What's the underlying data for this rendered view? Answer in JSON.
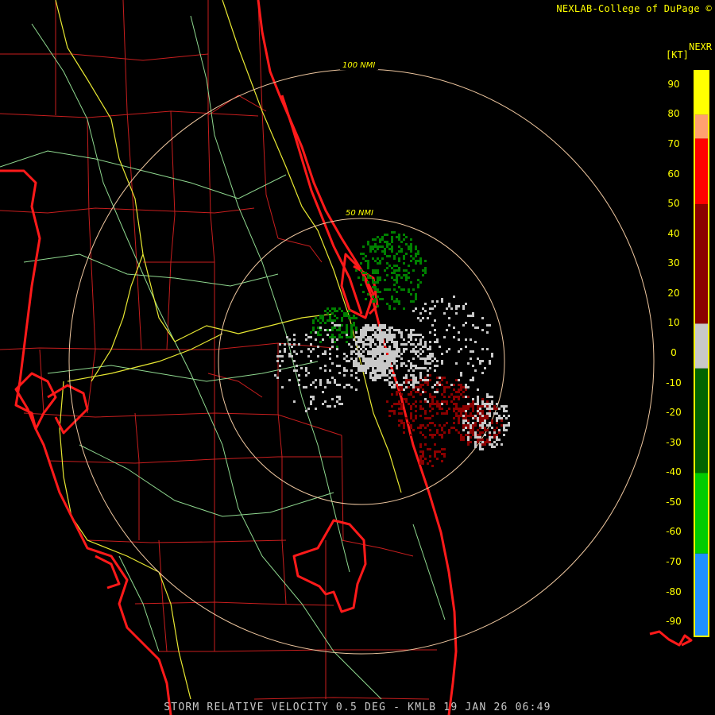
{
  "header": {
    "credit": "NEXLAB-College of DuPage",
    "credit_mark": "©",
    "product": "NEXR",
    "units": "[KT]"
  },
  "radar": {
    "site": "KMLB",
    "product_type": "Storm Relative Velocity",
    "tilt": "0.5 DEG",
    "range_rings": [
      "100 NMI",
      "50 NMI"
    ]
  },
  "legend": {
    "ticks": [
      "90",
      "80",
      "70",
      "60",
      "50",
      "40",
      "30",
      "20",
      "10",
      "0",
      "-10",
      "-20",
      "-30",
      "-40",
      "-50",
      "-60",
      "-70",
      "-80",
      "-90"
    ],
    "color_stops": [
      {
        "from": 95,
        "to": 80,
        "color": "#ffff00"
      },
      {
        "from": 80,
        "to": 72,
        "color": "#ffa070"
      },
      {
        "from": 72,
        "to": 50,
        "color": "#ff0000"
      },
      {
        "from": 50,
        "to": 10,
        "color": "#8b0000"
      },
      {
        "from": 10,
        "to": -5,
        "color": "#c8c8c8"
      },
      {
        "from": -5,
        "to": -40,
        "color": "#006400"
      },
      {
        "from": -40,
        "to": -67,
        "color": "#00cc00"
      },
      {
        "from": -67,
        "to": -95,
        "color": "#1e90ff"
      }
    ]
  },
  "colors": {
    "coast": "#ff1a1a",
    "county": "#c81e1e",
    "highway_major": "#e8e832",
    "highway_minor": "#8fd88f",
    "ring": "#f0c8a0",
    "inbound": "#008000",
    "outbound": "#8b0000",
    "near_zero": "#c8c8c8"
  },
  "footer": {
    "caption": "STORM RELATIVE VELOCITY 0.5 DEG - KMLB 19 JAN 26 06:49"
  }
}
